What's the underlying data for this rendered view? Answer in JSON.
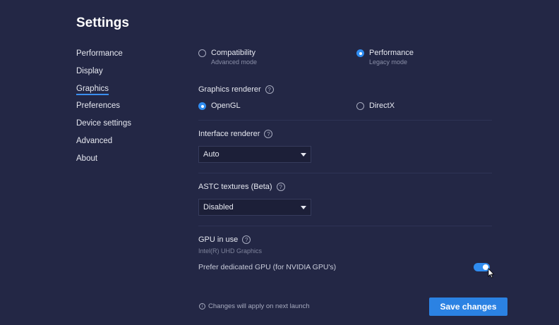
{
  "title": "Settings",
  "nav": {
    "items": [
      "Performance",
      "Display",
      "Graphics",
      "Preferences",
      "Device settings",
      "Advanced",
      "About"
    ],
    "active": "Graphics"
  },
  "graphics_mode": {
    "options": [
      {
        "label": "Compatibility",
        "sub": "Advanced mode",
        "selected": false
      },
      {
        "label": "Performance",
        "sub": "Legacy mode",
        "selected": true
      }
    ]
  },
  "graphics_renderer": {
    "label": "Graphics renderer",
    "options": [
      {
        "label": "OpenGL",
        "selected": true
      },
      {
        "label": "DirectX",
        "selected": false
      }
    ]
  },
  "interface_renderer": {
    "label": "Interface renderer",
    "value": "Auto"
  },
  "astc": {
    "label": "ASTC textures (Beta)",
    "value": "Disabled"
  },
  "gpu": {
    "label": "GPU in use",
    "name": "Intel(R) UHD Graphics",
    "prefer_label": "Prefer dedicated GPU (for NVIDIA GPU's)",
    "prefer_enabled": true
  },
  "footer": {
    "note": "Changes will apply on next launch",
    "save_label": "Save changes"
  },
  "icons": {
    "help": "help-circle-icon",
    "info": "info-icon",
    "dropdown": "chevron-down-icon"
  },
  "colors": {
    "background": "#232745",
    "accent": "#2b82e3"
  }
}
